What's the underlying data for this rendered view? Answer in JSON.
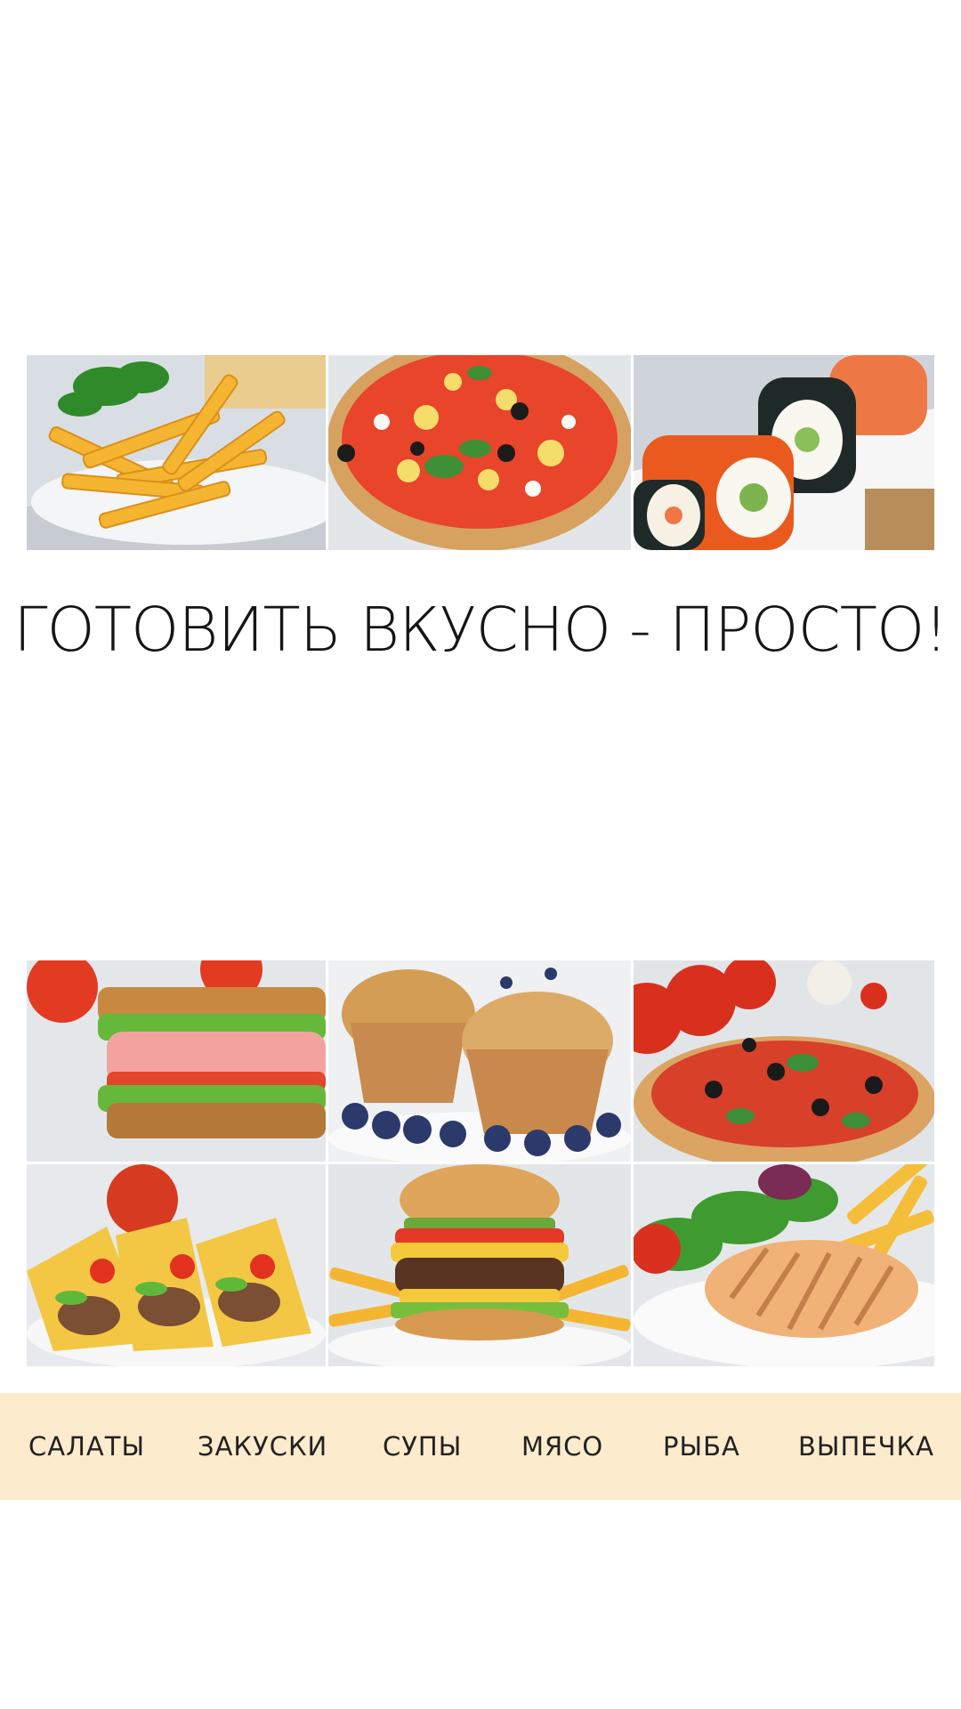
{
  "headline": "ГОТОВИТЬ ВКУСНО - ПРОСТО!",
  "top_gallery": [
    {
      "name": "french-fries"
    },
    {
      "name": "pizza"
    },
    {
      "name": "sushi-rolls"
    }
  ],
  "bottom_gallery": [
    {
      "name": "sandwich"
    },
    {
      "name": "muffins-blueberries"
    },
    {
      "name": "pizza-tomatoes"
    },
    {
      "name": "tacos"
    },
    {
      "name": "burger-fries"
    },
    {
      "name": "grilled-chicken-salad"
    }
  ],
  "nav": {
    "items": [
      {
        "label": "САЛАТЫ"
      },
      {
        "label": "ЗАКУСКИ"
      },
      {
        "label": "СУПЫ"
      },
      {
        "label": "МЯСО"
      },
      {
        "label": "РЫБА"
      },
      {
        "label": "ВЫПЕЧКА"
      }
    ]
  },
  "colors": {
    "nav_background": "#fdebcd",
    "text": "#151515",
    "page_background": "#ffffff"
  }
}
